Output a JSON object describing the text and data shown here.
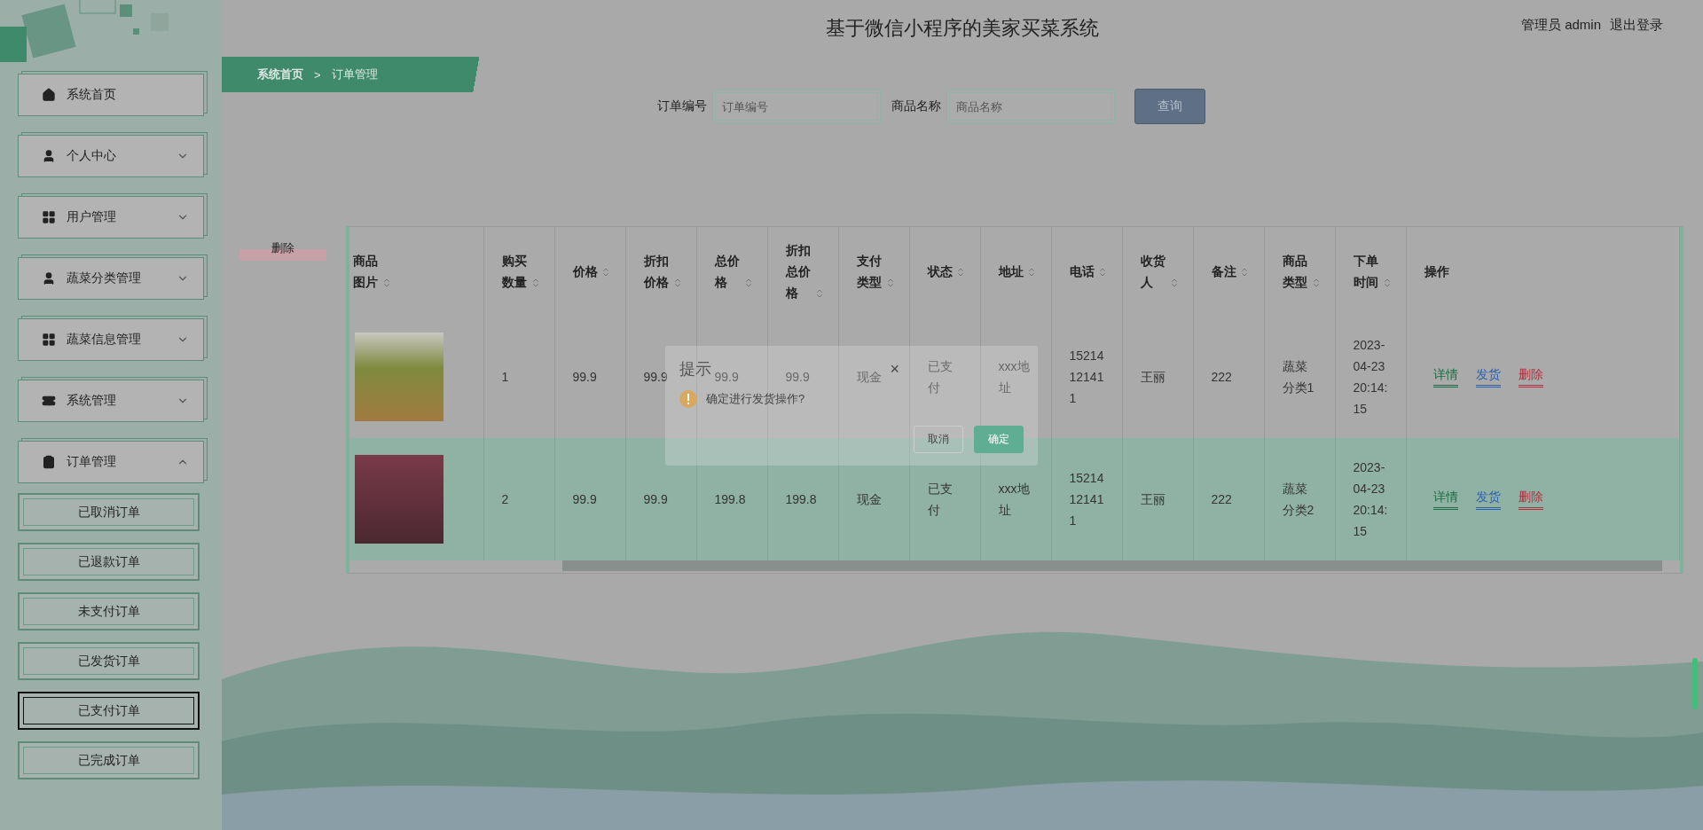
{
  "header": {
    "title": "基于微信小程序的美家买菜系统",
    "user_role": "管理员 admin",
    "logout": "退出登录"
  },
  "breadcrumb": [
    "系统首页",
    "订单管理"
  ],
  "breadcrumb_separator": ">",
  "search": {
    "fields": [
      {
        "label": "订单编号",
        "placeholder": "订单编号"
      },
      {
        "label": "商品名称",
        "placeholder": "商品名称"
      }
    ],
    "button": "查询"
  },
  "sidebar": {
    "items": [
      {
        "label": "系统首页"
      },
      {
        "label": "个人中心",
        "expanded": false
      },
      {
        "label": "用户管理",
        "expanded": false
      },
      {
        "label": "蔬菜分类管理",
        "expanded": false
      },
      {
        "label": "蔬菜信息管理",
        "expanded": false
      },
      {
        "label": "系统管理",
        "expanded": false
      },
      {
        "label": "订单管理",
        "expanded": true,
        "children": [
          {
            "label": "已取消订单",
            "selected": false
          },
          {
            "label": "已退款订单",
            "selected": false
          },
          {
            "label": "未支付订单",
            "selected": false
          },
          {
            "label": "已发货订单",
            "selected": false
          },
          {
            "label": "已支付订单",
            "selected": true
          },
          {
            "label": "已完成订单",
            "selected": false
          }
        ]
      }
    ]
  },
  "delete_button": "删除",
  "table": {
    "columns": [
      {
        "label": "商品图片",
        "sortable": true
      },
      {
        "label": "购买数量",
        "sortable": true
      },
      {
        "label": "价格",
        "sortable": true
      },
      {
        "label": "折扣价格",
        "sortable": true
      },
      {
        "label": "总价格",
        "sortable": true
      },
      {
        "label": "折扣总价格",
        "sortable": true
      },
      {
        "label": "支付类型",
        "sortable": true
      },
      {
        "label": "状态",
        "sortable": true
      },
      {
        "label": "地址",
        "sortable": true
      },
      {
        "label": "电话",
        "sortable": true
      },
      {
        "label": "收货人",
        "sortable": true
      },
      {
        "label": "备注",
        "sortable": true
      },
      {
        "label": "商品类型",
        "sortable": true
      },
      {
        "label": "下单时间",
        "sortable": true
      },
      {
        "label": "操作",
        "sortable": false
      }
    ],
    "rows": [
      {
        "highlighted": false,
        "cells": [
          "",
          "1",
          "99.9",
          "99.9",
          "99.9",
          "99.9",
          "现金",
          "已支付",
          "xxx地址",
          "15214121411",
          "王丽",
          "222",
          "蔬菜分类1",
          "2023-04-23 20:14:15"
        ],
        "actions": [
          {
            "label": "详情",
            "kind": "detail"
          },
          {
            "label": "发货",
            "kind": "ship"
          },
          {
            "label": "删除",
            "kind": "delete"
          }
        ]
      },
      {
        "highlighted": true,
        "cells": [
          "",
          "2",
          "99.9",
          "99.9",
          "199.8",
          "199.8",
          "现金",
          "已支付",
          "xxx地址",
          "15214121411",
          "王丽",
          "222",
          "蔬菜分类2",
          "2023-04-23 20:14:15"
        ],
        "actions": [
          {
            "label": "详情",
            "kind": "detail"
          },
          {
            "label": "发货",
            "kind": "ship"
          },
          {
            "label": "删除",
            "kind": "delete"
          }
        ]
      }
    ]
  },
  "dialog": {
    "title": "提示",
    "close": "×",
    "message": "确定进行发货操作?",
    "buttons": [
      {
        "label": "取消",
        "kind": "cancel"
      },
      {
        "label": "确定",
        "kind": "confirm"
      }
    ]
  }
}
